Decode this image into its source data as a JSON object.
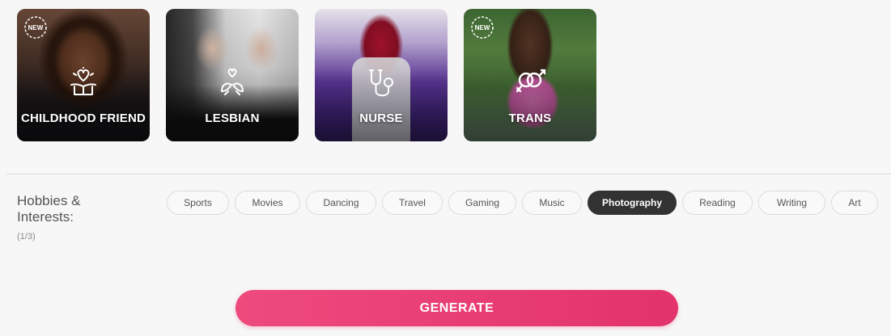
{
  "roles": [
    {
      "id": "childhood-friend",
      "label": "CHILDHOOD FRIEND",
      "is_new": true,
      "badge_text": "NEW",
      "icon": "heart-gift-icon"
    },
    {
      "id": "lesbian",
      "label": "LESBIAN",
      "is_new": false,
      "icon": "hearts-doves-icon"
    },
    {
      "id": "nurse",
      "label": "NURSE",
      "is_new": false,
      "icon": "stethoscope-icon"
    },
    {
      "id": "trans",
      "label": "TRANS",
      "is_new": true,
      "badge_text": "NEW",
      "icon": "transgender-symbol-icon"
    }
  ],
  "hobbies": {
    "title": "Hobbies & Interests:",
    "count": "(1/3)",
    "items": [
      {
        "label": "Sports",
        "selected": false
      },
      {
        "label": "Movies",
        "selected": false
      },
      {
        "label": "Dancing",
        "selected": false
      },
      {
        "label": "Travel",
        "selected": false
      },
      {
        "label": "Gaming",
        "selected": false
      },
      {
        "label": "Music",
        "selected": false
      },
      {
        "label": "Photography",
        "selected": true
      },
      {
        "label": "Reading",
        "selected": false
      },
      {
        "label": "Writing",
        "selected": false
      },
      {
        "label": "Art",
        "selected": false
      }
    ]
  },
  "generate_button": {
    "label": "GENERATE"
  },
  "colors": {
    "accent_start": "#ee4a7d",
    "accent_end": "#e2336a",
    "chip_selected_bg": "#333333",
    "background": "#f7f7f7"
  }
}
